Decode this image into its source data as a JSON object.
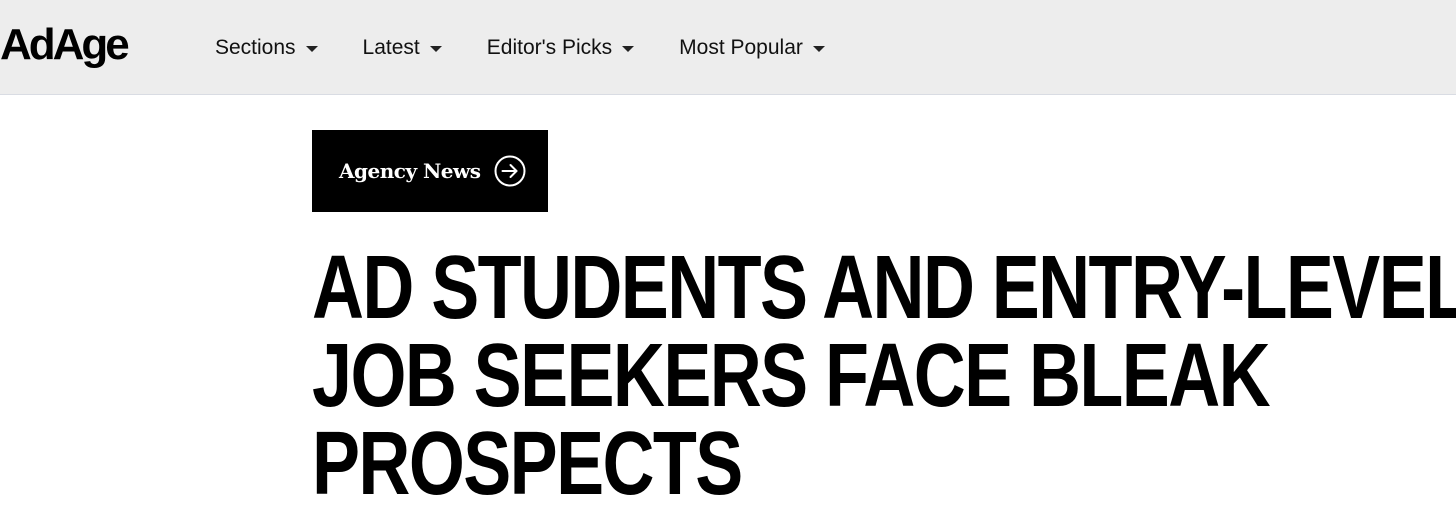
{
  "header": {
    "logo": "AdAge",
    "nav": [
      {
        "label": "Sections"
      },
      {
        "label": "Latest"
      },
      {
        "label": "Editor's Picks"
      },
      {
        "label": "Most Popular"
      }
    ]
  },
  "article": {
    "category": "Agency News",
    "headline_lines": [
      "AD STUDENTS AND ENTRY-LEVEL",
      "JOB SEEKERS FACE BLEAK",
      "PROSPECTS"
    ]
  },
  "icons": {
    "nav_caret": "chevron-down-icon",
    "category_arrow": "arrow-right-circle-icon"
  },
  "colors": {
    "header_bg": "#ededed",
    "header_border": "#d9dce3",
    "tag_bg": "#000000",
    "tag_text": "#ffffff",
    "headline": "#000000"
  }
}
